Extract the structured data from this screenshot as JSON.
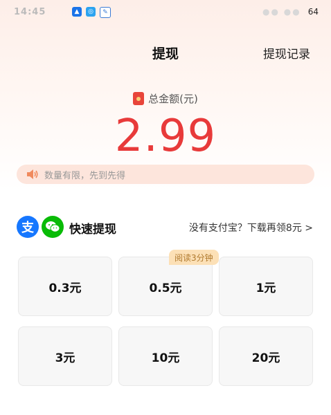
{
  "status_bar": {
    "time": "14:45",
    "battery_level": "64",
    "dots": "●● ●●"
  },
  "header": {
    "title": "提现",
    "records_link": "提现记录"
  },
  "balance": {
    "label": "总金额(元)",
    "amount": "2.99"
  },
  "notice": {
    "text": "数量有限，先到先得"
  },
  "quick_withdraw": {
    "title": "快速提现",
    "alipay_icon_glyph": "支",
    "download_link": "没有支付宝？下载再领8元 >"
  },
  "options": [
    {
      "label": "0.3元"
    },
    {
      "label": "0.5元",
      "badge": "阅读3分钟"
    },
    {
      "label": "1元"
    },
    {
      "label": "3元"
    },
    {
      "label": "10元"
    },
    {
      "label": "20元"
    }
  ],
  "colors": {
    "amount_red": "#e83a3a",
    "alipay_blue": "#1677ff",
    "wechat_green": "#09bb07",
    "notice_bg": "#fde5dc"
  }
}
